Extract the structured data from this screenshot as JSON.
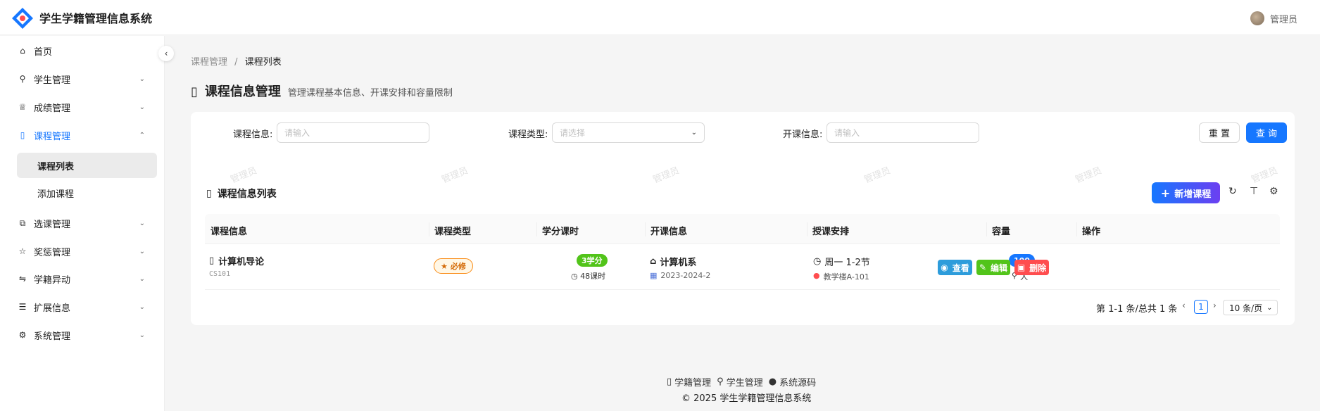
{
  "header": {
    "app_title": "学生学籍管理信息系统",
    "user_name": "管理员"
  },
  "sidebar": {
    "items": [
      {
        "label": "首页",
        "icon": "home-icon"
      },
      {
        "label": "学生管理",
        "icon": "user-icon"
      },
      {
        "label": "成绩管理",
        "icon": "trophy-icon"
      },
      {
        "label": "课程管理",
        "icon": "book-icon"
      },
      {
        "label": "选课管理",
        "icon": "select-icon"
      },
      {
        "label": "奖惩管理",
        "icon": "star-icon"
      },
      {
        "label": "学籍异动",
        "icon": "swap-icon"
      },
      {
        "label": "扩展信息",
        "icon": "list-icon"
      },
      {
        "label": "系统管理",
        "icon": "gear-icon"
      }
    ],
    "sub_items": [
      "课程列表",
      "添加课程"
    ]
  },
  "breadcrumb": {
    "parent": "课程管理",
    "separator": "/",
    "current": "课程列表"
  },
  "page": {
    "title": "课程信息管理",
    "description": "管理课程基本信息、开课安排和容量限制"
  },
  "filters": {
    "course_label": "课程信息:",
    "course_placeholder": "请输入",
    "type_label": "课程类型:",
    "type_placeholder": "请选择",
    "offering_label": "开课信息:",
    "offering_placeholder": "请输入",
    "reset_label": "重 置",
    "query_label": "查 询"
  },
  "table": {
    "title": "课程信息列表",
    "add_label": "新增课程",
    "watermark": "管理员",
    "columns": [
      "课程信息",
      "课程类型",
      "学分课时",
      "开课信息",
      "授课安排",
      "容量",
      "操作"
    ],
    "rows": [
      {
        "name": "计算机导论",
        "code": "CS101",
        "type": "必修",
        "credits": "3学分",
        "hours": "48课时",
        "department": "计算机系",
        "semester": "2023-2024-2",
        "time": "周一 1-2节",
        "room": "教学楼A-101",
        "capacity": "100",
        "capacity_unit": "人",
        "actions": {
          "view": "查看",
          "edit": "编辑",
          "delete": "删除"
        }
      }
    ]
  },
  "pagination": {
    "summary": "第 1-1 条/总共 1 条",
    "current_page": "1",
    "page_size": "10 条/页"
  },
  "footer": {
    "links": [
      "学籍管理",
      "学生管理",
      "系统源码"
    ],
    "copyright": "© 2025 学生学籍管理信息系统"
  },
  "colors": {
    "primary": "#1677ff",
    "success": "#52c41a",
    "danger": "#ff4d4f",
    "warning": "#fa8c16"
  }
}
